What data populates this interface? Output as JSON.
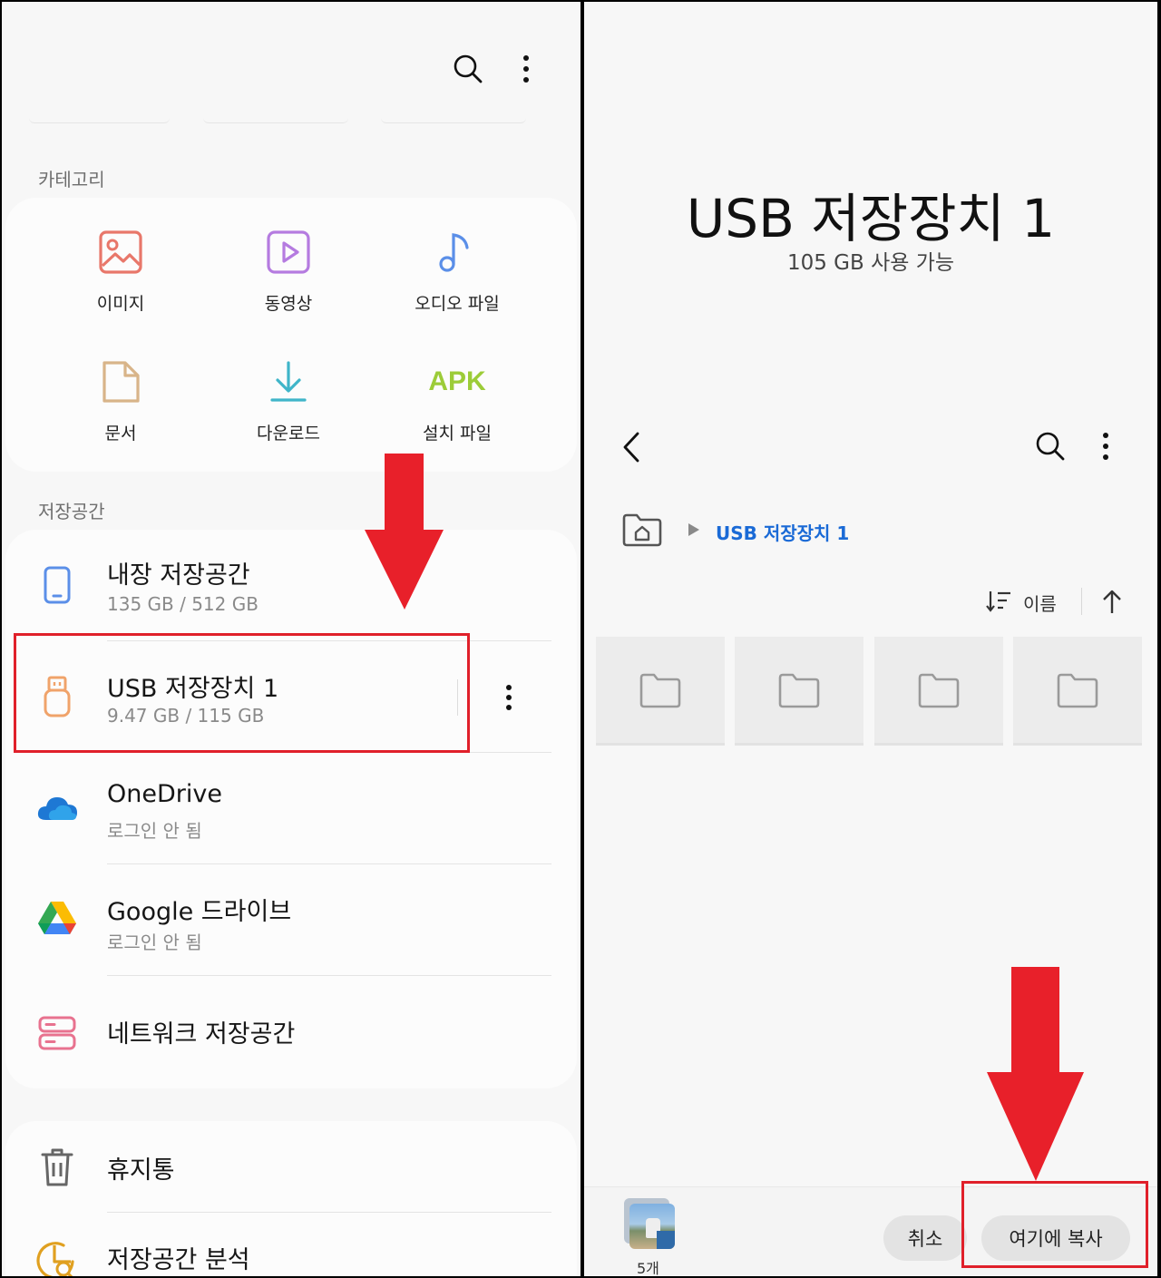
{
  "left_panel": {
    "categories": {
      "header": "카테고리",
      "items": [
        {
          "label": "이미지",
          "icon": "image-icon",
          "color": "#e8776a"
        },
        {
          "label": "동영상",
          "icon": "video-icon",
          "color": "#b57be0"
        },
        {
          "label": "오디오 파일",
          "icon": "music-note-icon",
          "color": "#5b8fe8"
        },
        {
          "label": "문서",
          "icon": "document-icon",
          "color": "#d8b489"
        },
        {
          "label": "다운로드",
          "icon": "download-icon",
          "color": "#3fb5c9"
        },
        {
          "label": "설치 파일",
          "icon": "apk-icon",
          "icon_text": "APK",
          "color": "#9ccc38"
        }
      ]
    },
    "storage": {
      "header": "저장공간",
      "items": [
        {
          "title": "내장 저장공간",
          "subtitle": "135 GB / 512 GB",
          "icon": "phone-icon"
        },
        {
          "title": "USB 저장장치 1",
          "subtitle": "9.47 GB / 115 GB",
          "icon": "usb-drive-icon"
        },
        {
          "title": "OneDrive",
          "subtitle": "로그인 안 됨",
          "icon": "onedrive-icon"
        },
        {
          "title": "Google 드라이브",
          "subtitle": "로그인 안 됨",
          "icon": "google-drive-icon"
        },
        {
          "title": "네트워크 저장공간",
          "subtitle": "",
          "icon": "network-storage-icon"
        }
      ]
    },
    "utilities": [
      {
        "title": "휴지통",
        "icon": "trash-icon"
      },
      {
        "title": "저장공간 분석",
        "icon": "storage-analysis-icon"
      }
    ]
  },
  "right_panel": {
    "title": "USB 저장장치 1",
    "available": "105 GB 사용 가능",
    "breadcrumb": "USB 저장장치 1",
    "sort_label": "이름",
    "folder_count": 4,
    "selection_count": "5개",
    "cancel_label": "취소",
    "copy_here_label": "여기에 복사"
  },
  "colors": {
    "highlight_red": "#e0202a",
    "link_blue": "#1a6ad6"
  }
}
